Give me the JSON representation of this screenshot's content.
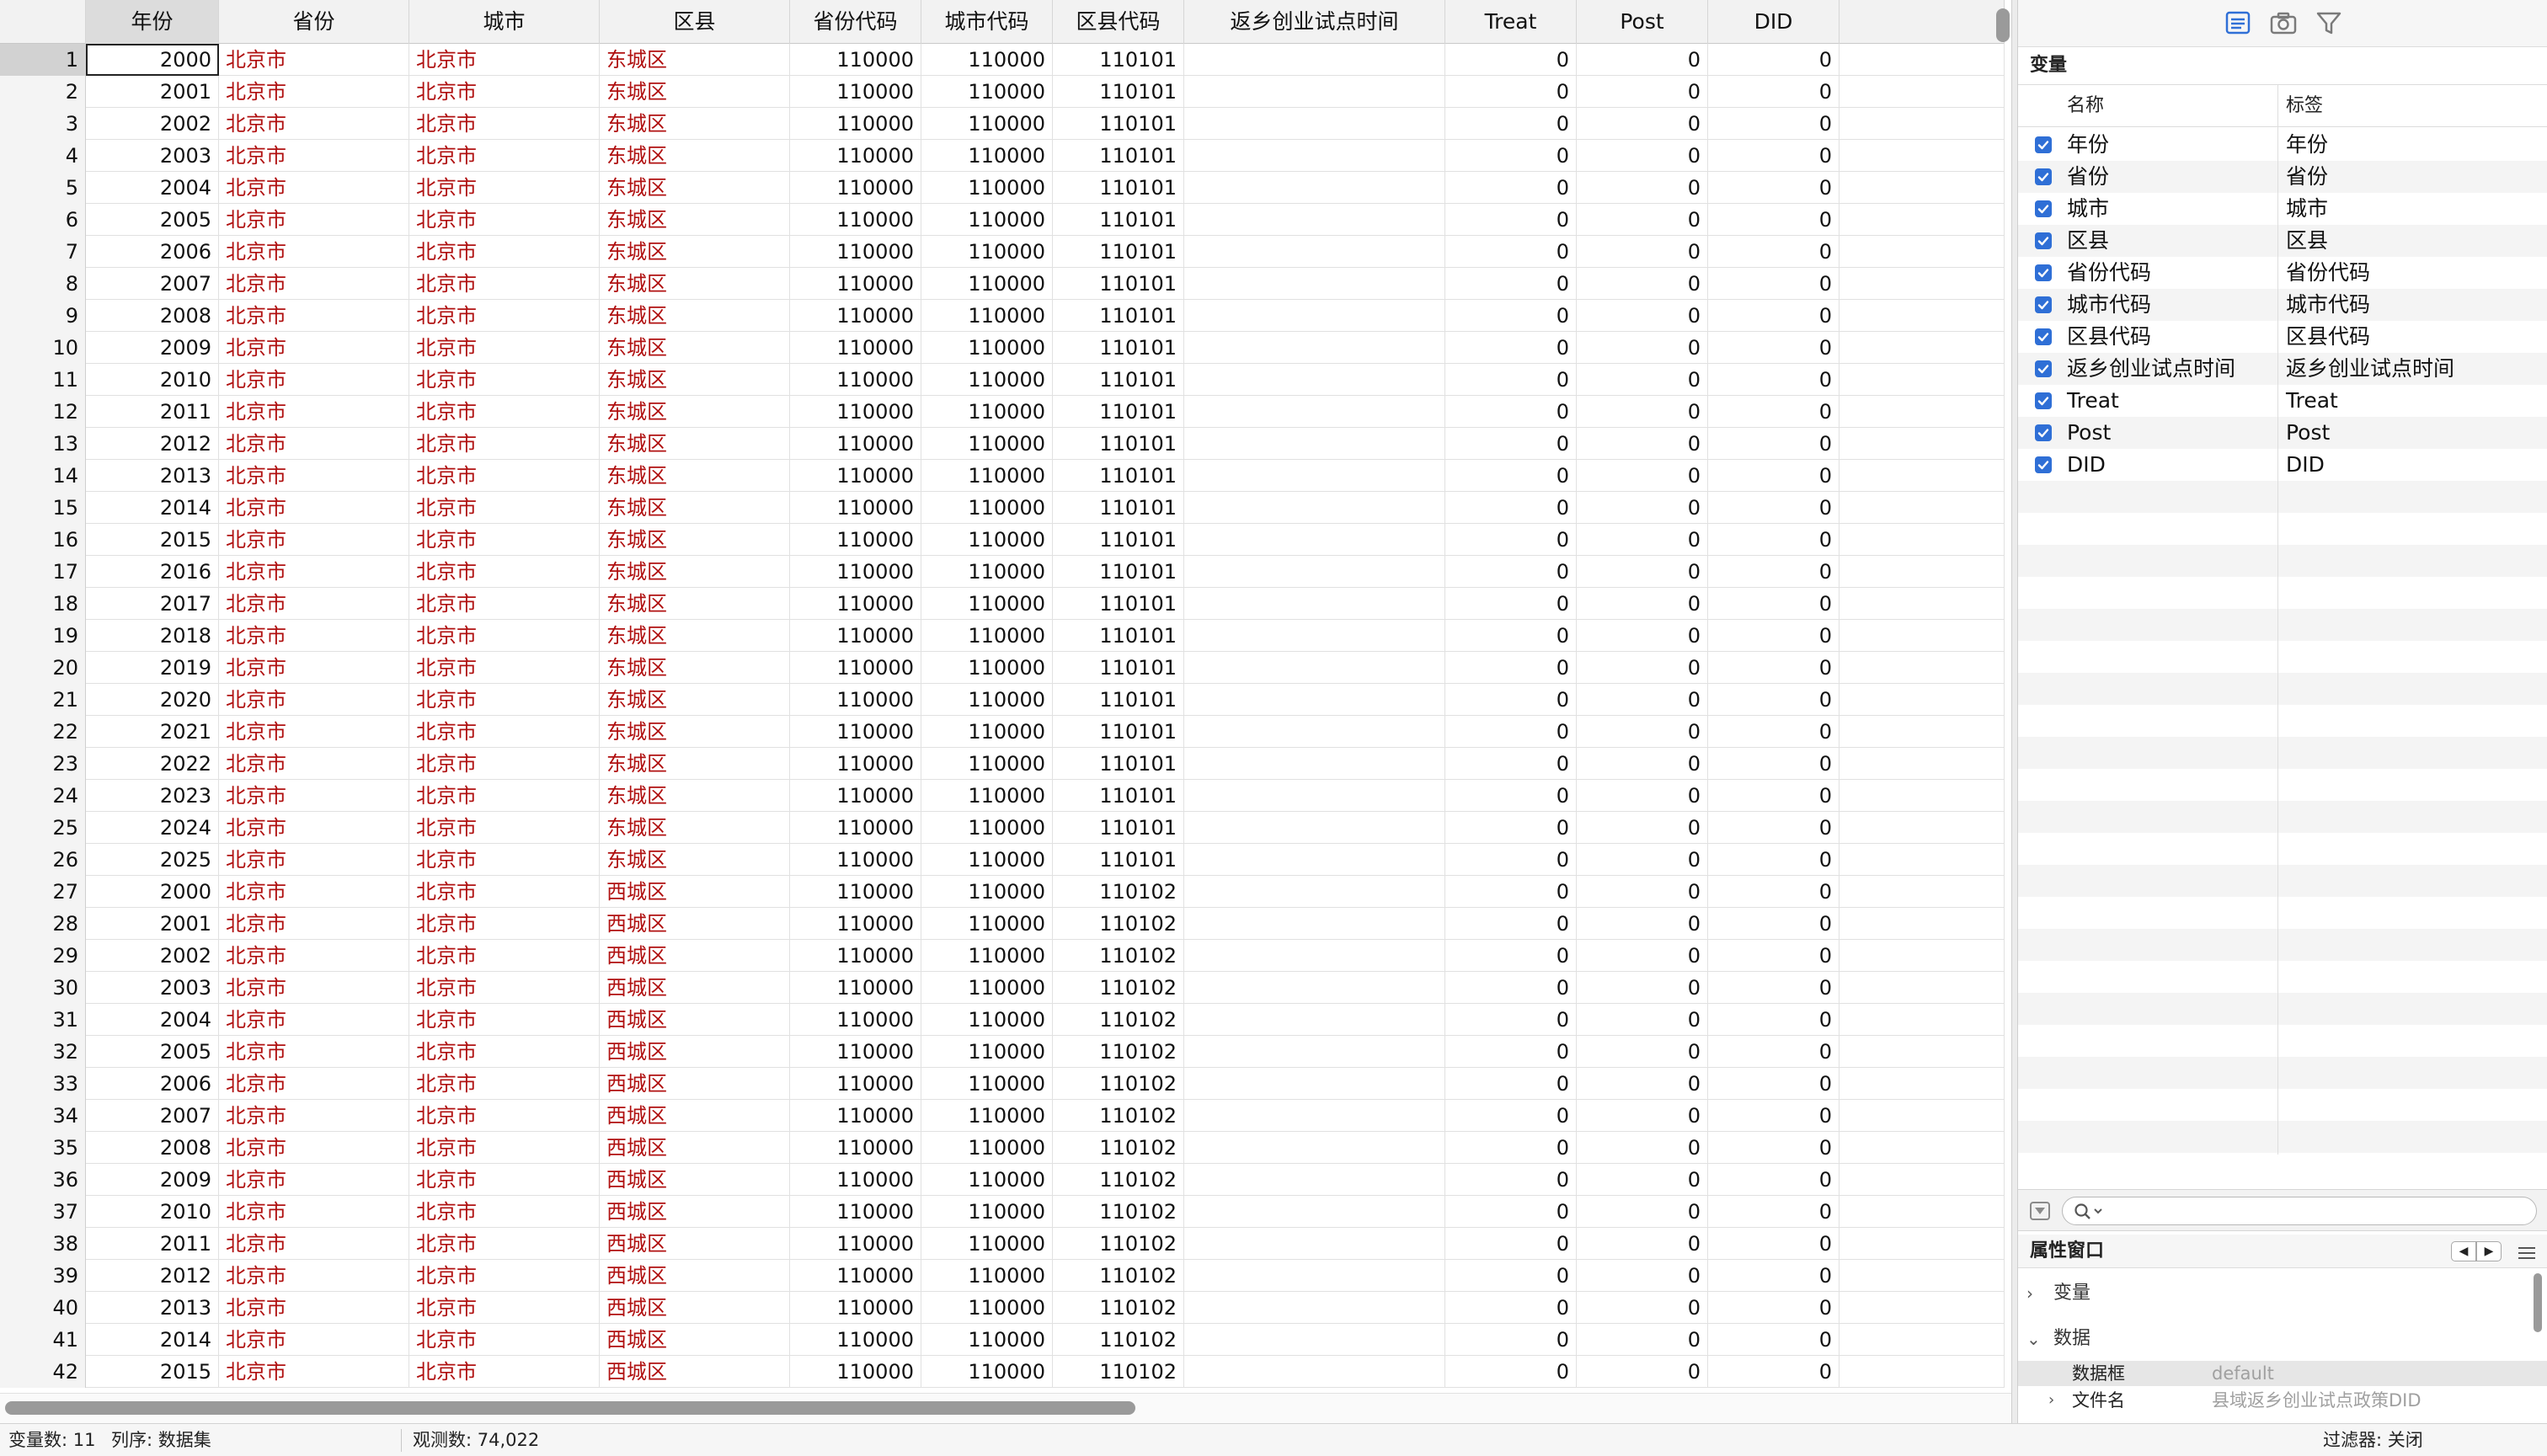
{
  "columns": [
    "年份",
    "省份",
    "城市",
    "区县",
    "省份代码",
    "城市代码",
    "区县代码",
    "返乡创业试点时间",
    "Treat",
    "Post",
    "DID"
  ],
  "rows": [
    {
      "n": "1",
      "year": "2000",
      "province": "北京市",
      "city": "北京市",
      "county": "东城区",
      "pcode": "110000",
      "ccode": "110000",
      "dcode": "110101",
      "pilot": "",
      "treat": "0",
      "post": "0",
      "did": "0"
    },
    {
      "n": "2",
      "year": "2001",
      "province": "北京市",
      "city": "北京市",
      "county": "东城区",
      "pcode": "110000",
      "ccode": "110000",
      "dcode": "110101",
      "pilot": "",
      "treat": "0",
      "post": "0",
      "did": "0"
    },
    {
      "n": "3",
      "year": "2002",
      "province": "北京市",
      "city": "北京市",
      "county": "东城区",
      "pcode": "110000",
      "ccode": "110000",
      "dcode": "110101",
      "pilot": "",
      "treat": "0",
      "post": "0",
      "did": "0"
    },
    {
      "n": "4",
      "year": "2003",
      "province": "北京市",
      "city": "北京市",
      "county": "东城区",
      "pcode": "110000",
      "ccode": "110000",
      "dcode": "110101",
      "pilot": "",
      "treat": "0",
      "post": "0",
      "did": "0"
    },
    {
      "n": "5",
      "year": "2004",
      "province": "北京市",
      "city": "北京市",
      "county": "东城区",
      "pcode": "110000",
      "ccode": "110000",
      "dcode": "110101",
      "pilot": "",
      "treat": "0",
      "post": "0",
      "did": "0"
    },
    {
      "n": "6",
      "year": "2005",
      "province": "北京市",
      "city": "北京市",
      "county": "东城区",
      "pcode": "110000",
      "ccode": "110000",
      "dcode": "110101",
      "pilot": "",
      "treat": "0",
      "post": "0",
      "did": "0"
    },
    {
      "n": "7",
      "year": "2006",
      "province": "北京市",
      "city": "北京市",
      "county": "东城区",
      "pcode": "110000",
      "ccode": "110000",
      "dcode": "110101",
      "pilot": "",
      "treat": "0",
      "post": "0",
      "did": "0"
    },
    {
      "n": "8",
      "year": "2007",
      "province": "北京市",
      "city": "北京市",
      "county": "东城区",
      "pcode": "110000",
      "ccode": "110000",
      "dcode": "110101",
      "pilot": "",
      "treat": "0",
      "post": "0",
      "did": "0"
    },
    {
      "n": "9",
      "year": "2008",
      "province": "北京市",
      "city": "北京市",
      "county": "东城区",
      "pcode": "110000",
      "ccode": "110000",
      "dcode": "110101",
      "pilot": "",
      "treat": "0",
      "post": "0",
      "did": "0"
    },
    {
      "n": "10",
      "year": "2009",
      "province": "北京市",
      "city": "北京市",
      "county": "东城区",
      "pcode": "110000",
      "ccode": "110000",
      "dcode": "110101",
      "pilot": "",
      "treat": "0",
      "post": "0",
      "did": "0"
    },
    {
      "n": "11",
      "year": "2010",
      "province": "北京市",
      "city": "北京市",
      "county": "东城区",
      "pcode": "110000",
      "ccode": "110000",
      "dcode": "110101",
      "pilot": "",
      "treat": "0",
      "post": "0",
      "did": "0"
    },
    {
      "n": "12",
      "year": "2011",
      "province": "北京市",
      "city": "北京市",
      "county": "东城区",
      "pcode": "110000",
      "ccode": "110000",
      "dcode": "110101",
      "pilot": "",
      "treat": "0",
      "post": "0",
      "did": "0"
    },
    {
      "n": "13",
      "year": "2012",
      "province": "北京市",
      "city": "北京市",
      "county": "东城区",
      "pcode": "110000",
      "ccode": "110000",
      "dcode": "110101",
      "pilot": "",
      "treat": "0",
      "post": "0",
      "did": "0"
    },
    {
      "n": "14",
      "year": "2013",
      "province": "北京市",
      "city": "北京市",
      "county": "东城区",
      "pcode": "110000",
      "ccode": "110000",
      "dcode": "110101",
      "pilot": "",
      "treat": "0",
      "post": "0",
      "did": "0"
    },
    {
      "n": "15",
      "year": "2014",
      "province": "北京市",
      "city": "北京市",
      "county": "东城区",
      "pcode": "110000",
      "ccode": "110000",
      "dcode": "110101",
      "pilot": "",
      "treat": "0",
      "post": "0",
      "did": "0"
    },
    {
      "n": "16",
      "year": "2015",
      "province": "北京市",
      "city": "北京市",
      "county": "东城区",
      "pcode": "110000",
      "ccode": "110000",
      "dcode": "110101",
      "pilot": "",
      "treat": "0",
      "post": "0",
      "did": "0"
    },
    {
      "n": "17",
      "year": "2016",
      "province": "北京市",
      "city": "北京市",
      "county": "东城区",
      "pcode": "110000",
      "ccode": "110000",
      "dcode": "110101",
      "pilot": "",
      "treat": "0",
      "post": "0",
      "did": "0"
    },
    {
      "n": "18",
      "year": "2017",
      "province": "北京市",
      "city": "北京市",
      "county": "东城区",
      "pcode": "110000",
      "ccode": "110000",
      "dcode": "110101",
      "pilot": "",
      "treat": "0",
      "post": "0",
      "did": "0"
    },
    {
      "n": "19",
      "year": "2018",
      "province": "北京市",
      "city": "北京市",
      "county": "东城区",
      "pcode": "110000",
      "ccode": "110000",
      "dcode": "110101",
      "pilot": "",
      "treat": "0",
      "post": "0",
      "did": "0"
    },
    {
      "n": "20",
      "year": "2019",
      "province": "北京市",
      "city": "北京市",
      "county": "东城区",
      "pcode": "110000",
      "ccode": "110000",
      "dcode": "110101",
      "pilot": "",
      "treat": "0",
      "post": "0",
      "did": "0"
    },
    {
      "n": "21",
      "year": "2020",
      "province": "北京市",
      "city": "北京市",
      "county": "东城区",
      "pcode": "110000",
      "ccode": "110000",
      "dcode": "110101",
      "pilot": "",
      "treat": "0",
      "post": "0",
      "did": "0"
    },
    {
      "n": "22",
      "year": "2021",
      "province": "北京市",
      "city": "北京市",
      "county": "东城区",
      "pcode": "110000",
      "ccode": "110000",
      "dcode": "110101",
      "pilot": "",
      "treat": "0",
      "post": "0",
      "did": "0"
    },
    {
      "n": "23",
      "year": "2022",
      "province": "北京市",
      "city": "北京市",
      "county": "东城区",
      "pcode": "110000",
      "ccode": "110000",
      "dcode": "110101",
      "pilot": "",
      "treat": "0",
      "post": "0",
      "did": "0"
    },
    {
      "n": "24",
      "year": "2023",
      "province": "北京市",
      "city": "北京市",
      "county": "东城区",
      "pcode": "110000",
      "ccode": "110000",
      "dcode": "110101",
      "pilot": "",
      "treat": "0",
      "post": "0",
      "did": "0"
    },
    {
      "n": "25",
      "year": "2024",
      "province": "北京市",
      "city": "北京市",
      "county": "东城区",
      "pcode": "110000",
      "ccode": "110000",
      "dcode": "110101",
      "pilot": "",
      "treat": "0",
      "post": "0",
      "did": "0"
    },
    {
      "n": "26",
      "year": "2025",
      "province": "北京市",
      "city": "北京市",
      "county": "东城区",
      "pcode": "110000",
      "ccode": "110000",
      "dcode": "110101",
      "pilot": "",
      "treat": "0",
      "post": "0",
      "did": "0"
    },
    {
      "n": "27",
      "year": "2000",
      "province": "北京市",
      "city": "北京市",
      "county": "西城区",
      "pcode": "110000",
      "ccode": "110000",
      "dcode": "110102",
      "pilot": "",
      "treat": "0",
      "post": "0",
      "did": "0"
    },
    {
      "n": "28",
      "year": "2001",
      "province": "北京市",
      "city": "北京市",
      "county": "西城区",
      "pcode": "110000",
      "ccode": "110000",
      "dcode": "110102",
      "pilot": "",
      "treat": "0",
      "post": "0",
      "did": "0"
    },
    {
      "n": "29",
      "year": "2002",
      "province": "北京市",
      "city": "北京市",
      "county": "西城区",
      "pcode": "110000",
      "ccode": "110000",
      "dcode": "110102",
      "pilot": "",
      "treat": "0",
      "post": "0",
      "did": "0"
    },
    {
      "n": "30",
      "year": "2003",
      "province": "北京市",
      "city": "北京市",
      "county": "西城区",
      "pcode": "110000",
      "ccode": "110000",
      "dcode": "110102",
      "pilot": "",
      "treat": "0",
      "post": "0",
      "did": "0"
    },
    {
      "n": "31",
      "year": "2004",
      "province": "北京市",
      "city": "北京市",
      "county": "西城区",
      "pcode": "110000",
      "ccode": "110000",
      "dcode": "110102",
      "pilot": "",
      "treat": "0",
      "post": "0",
      "did": "0"
    },
    {
      "n": "32",
      "year": "2005",
      "province": "北京市",
      "city": "北京市",
      "county": "西城区",
      "pcode": "110000",
      "ccode": "110000",
      "dcode": "110102",
      "pilot": "",
      "treat": "0",
      "post": "0",
      "did": "0"
    },
    {
      "n": "33",
      "year": "2006",
      "province": "北京市",
      "city": "北京市",
      "county": "西城区",
      "pcode": "110000",
      "ccode": "110000",
      "dcode": "110102",
      "pilot": "",
      "treat": "0",
      "post": "0",
      "did": "0"
    },
    {
      "n": "34",
      "year": "2007",
      "province": "北京市",
      "city": "北京市",
      "county": "西城区",
      "pcode": "110000",
      "ccode": "110000",
      "dcode": "110102",
      "pilot": "",
      "treat": "0",
      "post": "0",
      "did": "0"
    },
    {
      "n": "35",
      "year": "2008",
      "province": "北京市",
      "city": "北京市",
      "county": "西城区",
      "pcode": "110000",
      "ccode": "110000",
      "dcode": "110102",
      "pilot": "",
      "treat": "0",
      "post": "0",
      "did": "0"
    },
    {
      "n": "36",
      "year": "2009",
      "province": "北京市",
      "city": "北京市",
      "county": "西城区",
      "pcode": "110000",
      "ccode": "110000",
      "dcode": "110102",
      "pilot": "",
      "treat": "0",
      "post": "0",
      "did": "0"
    },
    {
      "n": "37",
      "year": "2010",
      "province": "北京市",
      "city": "北京市",
      "county": "西城区",
      "pcode": "110000",
      "ccode": "110000",
      "dcode": "110102",
      "pilot": "",
      "treat": "0",
      "post": "0",
      "did": "0"
    },
    {
      "n": "38",
      "year": "2011",
      "province": "北京市",
      "city": "北京市",
      "county": "西城区",
      "pcode": "110000",
      "ccode": "110000",
      "dcode": "110102",
      "pilot": "",
      "treat": "0",
      "post": "0",
      "did": "0"
    },
    {
      "n": "39",
      "year": "2012",
      "province": "北京市",
      "city": "北京市",
      "county": "西城区",
      "pcode": "110000",
      "ccode": "110000",
      "dcode": "110102",
      "pilot": "",
      "treat": "0",
      "post": "0",
      "did": "0"
    },
    {
      "n": "40",
      "year": "2013",
      "province": "北京市",
      "city": "北京市",
      "county": "西城区",
      "pcode": "110000",
      "ccode": "110000",
      "dcode": "110102",
      "pilot": "",
      "treat": "0",
      "post": "0",
      "did": "0"
    },
    {
      "n": "41",
      "year": "2014",
      "province": "北京市",
      "city": "北京市",
      "county": "西城区",
      "pcode": "110000",
      "ccode": "110000",
      "dcode": "110102",
      "pilot": "",
      "treat": "0",
      "post": "0",
      "did": "0"
    },
    {
      "n": "42",
      "year": "2015",
      "province": "北京市",
      "city": "北京市",
      "county": "西城区",
      "pcode": "110000",
      "ccode": "110000",
      "dcode": "110102",
      "pilot": "",
      "treat": "0",
      "post": "0",
      "did": "0"
    }
  ],
  "toolbar": {
    "icons": [
      "variables-list-icon",
      "snapshot-camera-icon",
      "filter-funnel-icon"
    ]
  },
  "variables": {
    "title": "变量",
    "col_name": "名称",
    "col_label": "标签",
    "items": [
      {
        "name": "年份",
        "label": "年份",
        "checked": true
      },
      {
        "name": "省份",
        "label": "省份",
        "checked": true
      },
      {
        "name": "城市",
        "label": "城市",
        "checked": true
      },
      {
        "name": "区县",
        "label": "区县",
        "checked": true
      },
      {
        "name": "省份代码",
        "label": "省份代码",
        "checked": true
      },
      {
        "name": "城市代码",
        "label": "城市代码",
        "checked": true
      },
      {
        "name": "区县代码",
        "label": "区县代码",
        "checked": true
      },
      {
        "name": "返乡创业试点时间",
        "label": "返乡创业试点时间",
        "checked": true
      },
      {
        "name": "Treat",
        "label": "Treat",
        "checked": true
      },
      {
        "name": "Post",
        "label": "Post",
        "checked": true
      },
      {
        "name": "DID",
        "label": "DID",
        "checked": true
      }
    ],
    "filter_placeholder": ""
  },
  "properties": {
    "title": "属性窗口",
    "nav_prev": "◀",
    "nav_next": "▶",
    "variables_section": "变量",
    "data_section": "数据",
    "frame_key": "数据框",
    "frame_value": "default",
    "filename_key": "文件名",
    "filename_value": "县域返乡创业试点政策DID"
  },
  "status": {
    "vars": "变量数:  11",
    "order": "列序:  数据集",
    "obs": "观测数:  74,022",
    "filter": "过滤器:  关闭"
  },
  "colors": {
    "string_text": "#b01010",
    "checkbox": "#2f6fd6"
  }
}
